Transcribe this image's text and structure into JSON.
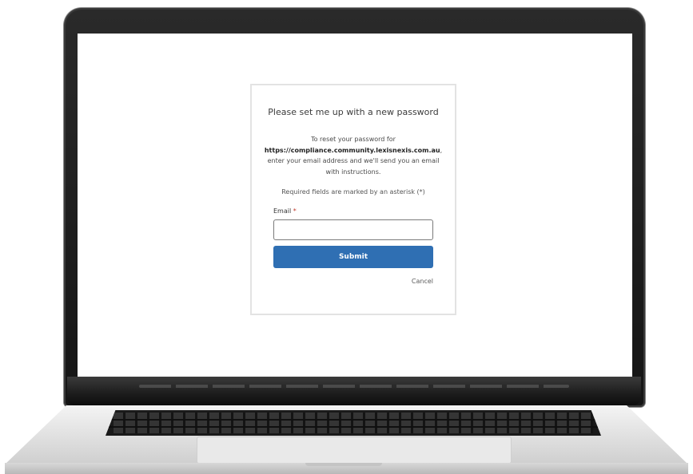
{
  "reset": {
    "title": "Please set me up with a new password",
    "desc_prefix": "To reset your password for",
    "url": "https://compliance.community.lexisnexis.com.au",
    "desc_suffix": ", enter your email address and we'll send you an email with instructions.",
    "required_note": "Required fields are marked by an asterisk (*)",
    "email_label": "Email",
    "email_required_marker": "*",
    "email_value": "",
    "submit_label": "Submit",
    "cancel_label": "Cancel"
  },
  "colors": {
    "submit_bg": "#2f6fb3",
    "laptop_bezel": "#1a1a1a",
    "laptop_body": "#d9d9d9"
  }
}
